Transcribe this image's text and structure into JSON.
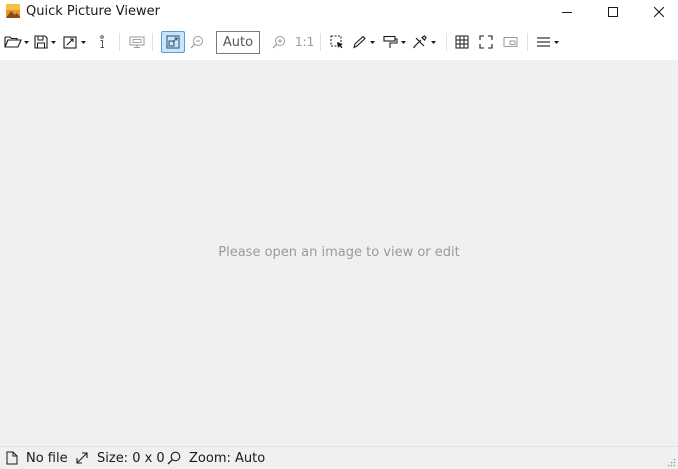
{
  "window": {
    "title": "Quick Picture Viewer",
    "icon": "landscape-photo-icon",
    "controls": [
      "minimize-icon",
      "maximize-icon",
      "close-icon"
    ]
  },
  "toolbar": {
    "zoom_value": "Auto",
    "original_size_label": "1:1",
    "active_tool": "auto-zoom-button",
    "items": [
      "open-folder-icon",
      "save-icon",
      "export-icon",
      "info-icon",
      "slideshow-icon",
      "auto-zoom-icon",
      "zoom-out-icon",
      "zoom-in-icon",
      "select-icon",
      "draw-icon",
      "paint-icon",
      "tools-icon",
      "grid-icon",
      "fullscreen-icon",
      "picture-in-picture-icon",
      "menu-icon"
    ]
  },
  "main": {
    "empty_message": "Please open an image to view or edit"
  },
  "status": {
    "file": "No file",
    "size": "Size: 0 x 0",
    "zoom": "Zoom: Auto"
  },
  "colors": {
    "canvas_bg": "#f0f0f0",
    "active_bg": "#cce4f7",
    "active_border": "#5b9bd5",
    "icon_color": "#1a1a1a",
    "disabled_color": "#999999"
  }
}
